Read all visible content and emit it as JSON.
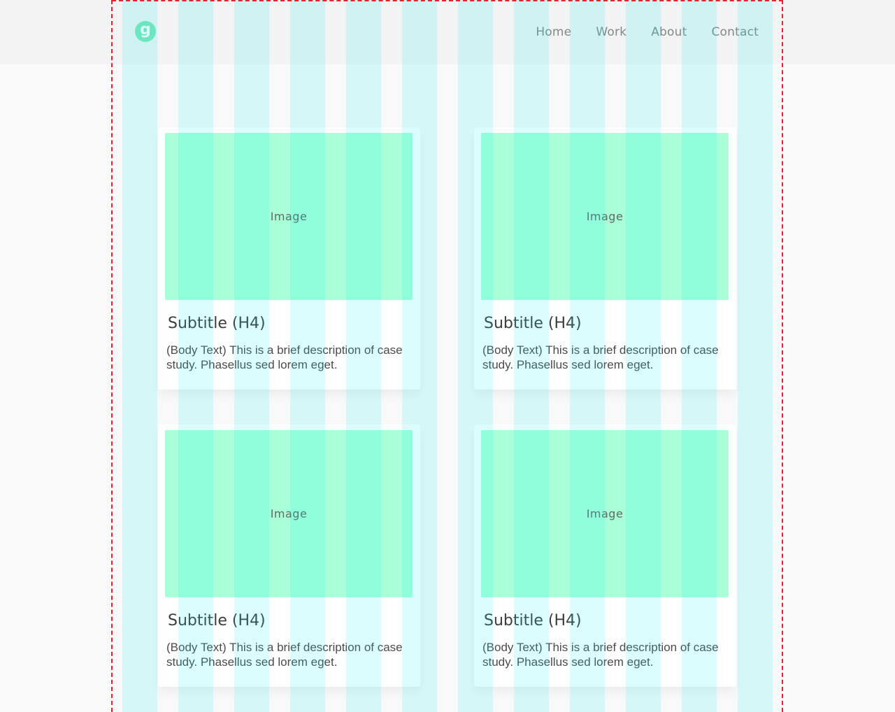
{
  "logo": {
    "letter": "g",
    "color": "#7fe3b8"
  },
  "nav": {
    "items": [
      {
        "label": "Home"
      },
      {
        "label": "Work"
      },
      {
        "label": "About"
      },
      {
        "label": "Contact"
      }
    ]
  },
  "cards": [
    {
      "image_label": "Image",
      "title": "Subtitle (H4)",
      "body": "(Body Text) This is a brief description of case study. Phasellus sed lorem eget."
    },
    {
      "image_label": "Image",
      "title": "Subtitle (H4)",
      "body": "(Body Text) This is a brief description of case study. Phasellus sed lorem eget."
    },
    {
      "image_label": "Image",
      "title": "Subtitle (H4)",
      "body": "(Body Text) This is a brief description of case study. Phasellus sed lorem eget."
    },
    {
      "image_label": "Image",
      "title": "Subtitle (H4)",
      "body": "(Body Text) This is a brief description of case study. Phasellus sed lorem eget."
    }
  ],
  "colors": {
    "page_background": "#f9f9f9",
    "header_background": "#f3f3f3",
    "image_placeholder": "#a8ffd8",
    "grid_overlay": "#00f0f0",
    "guide_lines": "#e0242f"
  }
}
